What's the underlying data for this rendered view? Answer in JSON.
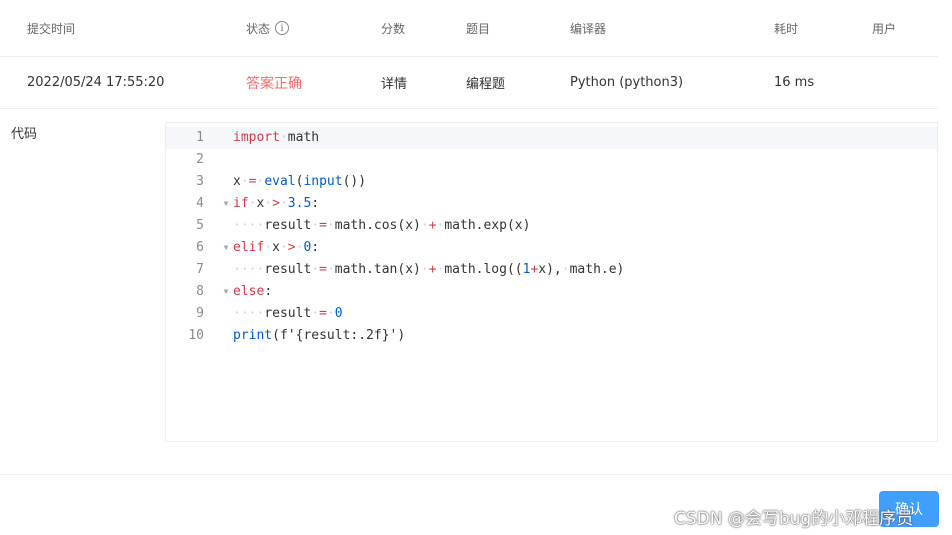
{
  "table": {
    "headers": {
      "submit_time": "提交时间",
      "status": "状态",
      "score": "分数",
      "problem": "题目",
      "compiler": "编译器",
      "time_cost": "耗时",
      "user": "用户"
    },
    "status_info_icon": "info-circle-icon",
    "row": {
      "submit_time": "2022/05/24 17:55:20",
      "status": "答案正确",
      "score": "详情",
      "problem": "编程题",
      "compiler": "Python (python3)",
      "time_cost": "16 ms",
      "user": ""
    }
  },
  "code_label": "代码",
  "editor": {
    "line_numbers": [
      "1",
      "2",
      "3",
      "4",
      "5",
      "6",
      "7",
      "8",
      "9",
      "10"
    ]
  },
  "confirm_button": "确认",
  "watermark": "CSDN @会写bug的小邓程序员",
  "colors": {
    "status_ok": "#f56c6c",
    "primary": "#409eff",
    "keyword": "#d73a49",
    "function": "#005cc5"
  }
}
